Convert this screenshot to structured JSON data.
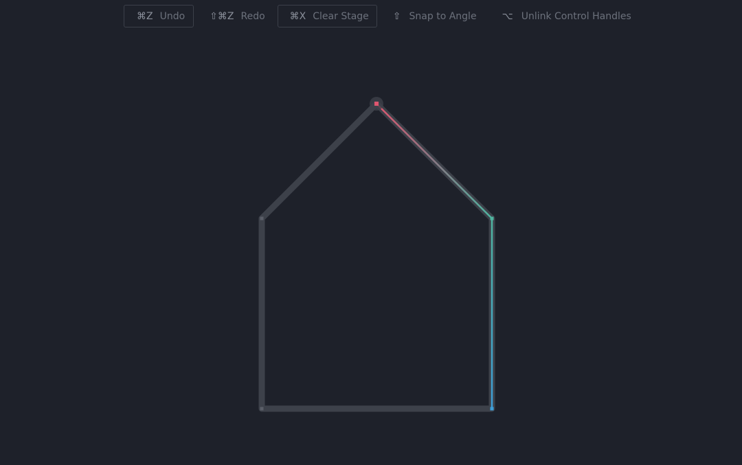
{
  "toolbar": {
    "undo": {
      "key": "⌘Z",
      "label": "Undo"
    },
    "redo": {
      "key": "⇧⌘Z",
      "label": "Redo"
    },
    "clear": {
      "key": "⌘X",
      "label": "Clear Stage"
    },
    "snap": {
      "key": "⇧",
      "label": "Snap to Angle"
    },
    "unlink": {
      "key": "⌥",
      "label": "Unlink Control Handles"
    }
  },
  "colors": {
    "background": "#1e212a",
    "path_stroke": "#3d414a",
    "active_pink": "#e0566f",
    "active_teal": "#4fb5a0",
    "active_blue": "#3d9ed8",
    "anchor": "#5a5e68"
  },
  "icons": {
    "snap": "shift-arrow-icon",
    "unlink": "option-key-icon"
  }
}
